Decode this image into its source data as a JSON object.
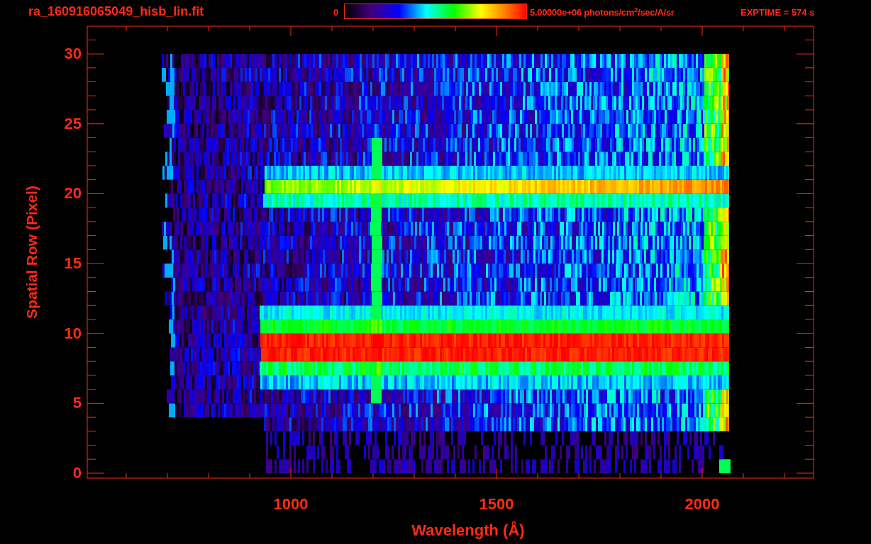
{
  "title": "ra_160916065049_hisb_lin.fit",
  "colorbar": {
    "min_label": "0",
    "max_label": "5.00000e+06 photons/cm$^{2}$/sec/A/sr"
  },
  "exposure": "EXPTIME = 574 s",
  "plot": {
    "xlabel": "Wavelength (Å)",
    "ylabel": "Spatial Row (Pixel)",
    "xtick_labels": [
      "1000",
      "1500",
      "2000"
    ],
    "ytick_labels": [
      "30",
      "25",
      "20",
      "15",
      "10",
      "5",
      "0"
    ]
  }
}
